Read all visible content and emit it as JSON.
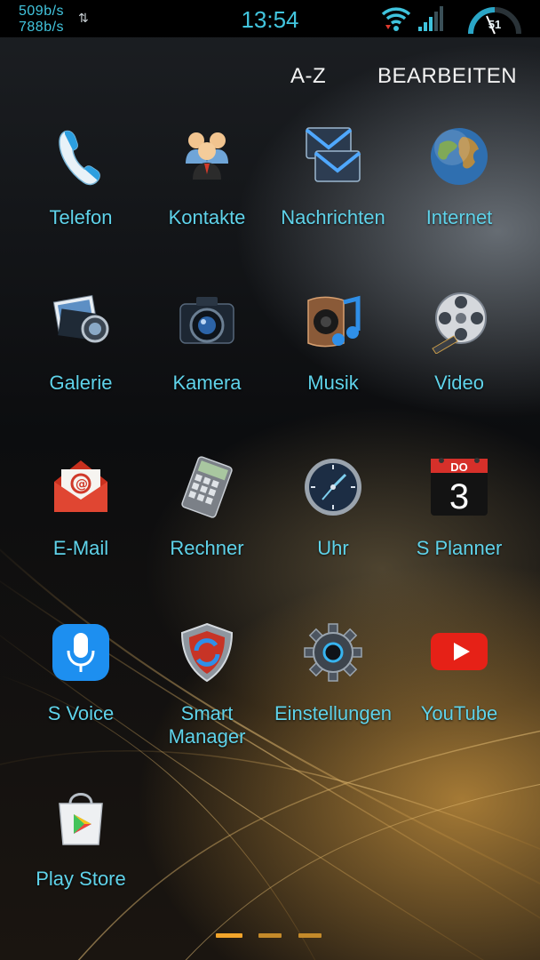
{
  "status_bar": {
    "upload_rate": "509b/s",
    "download_rate": "788b/s",
    "time": "13:54",
    "battery_level": "51",
    "icons": [
      "data-transfer-icon",
      "wifi-icon",
      "signal-strength-icon",
      "battery-gauge-icon"
    ]
  },
  "header": {
    "sort_label": "A-Z",
    "edit_label": "BEARBEITEN"
  },
  "apps": [
    {
      "label": "Telefon",
      "icon": "phone-icon"
    },
    {
      "label": "Kontakte",
      "icon": "contacts-icon"
    },
    {
      "label": "Nachrichten",
      "icon": "messages-icon"
    },
    {
      "label": "Internet",
      "icon": "globe-icon"
    },
    {
      "label": "Galerie",
      "icon": "gallery-icon"
    },
    {
      "label": "Kamera",
      "icon": "camera-icon"
    },
    {
      "label": "Musik",
      "icon": "music-icon"
    },
    {
      "label": "Video",
      "icon": "film-reel-icon"
    },
    {
      "label": "E-Mail",
      "icon": "email-icon"
    },
    {
      "label": "Rechner",
      "icon": "calculator-icon"
    },
    {
      "label": "Uhr",
      "icon": "clock-icon"
    },
    {
      "label": "S Planner",
      "icon": "calendar-icon"
    },
    {
      "label": "S Voice",
      "icon": "microphone-icon"
    },
    {
      "label": "Smart Manager",
      "icon": "shield-icon"
    },
    {
      "label": "Einstellungen",
      "icon": "gear-icon"
    },
    {
      "label": "YouTube",
      "icon": "youtube-icon"
    },
    {
      "label": "Play Store",
      "icon": "play-store-bag-icon"
    }
  ],
  "calendar_icon": {
    "day_abbr": "DO",
    "day_number": "3"
  },
  "pager": {
    "pages": 3,
    "current": 1
  },
  "colors": {
    "label_text": "#5fd3ea",
    "status_text": "#42c5de",
    "pager_active": "#f2a52b",
    "pager_inactive": "#c48a2a"
  }
}
